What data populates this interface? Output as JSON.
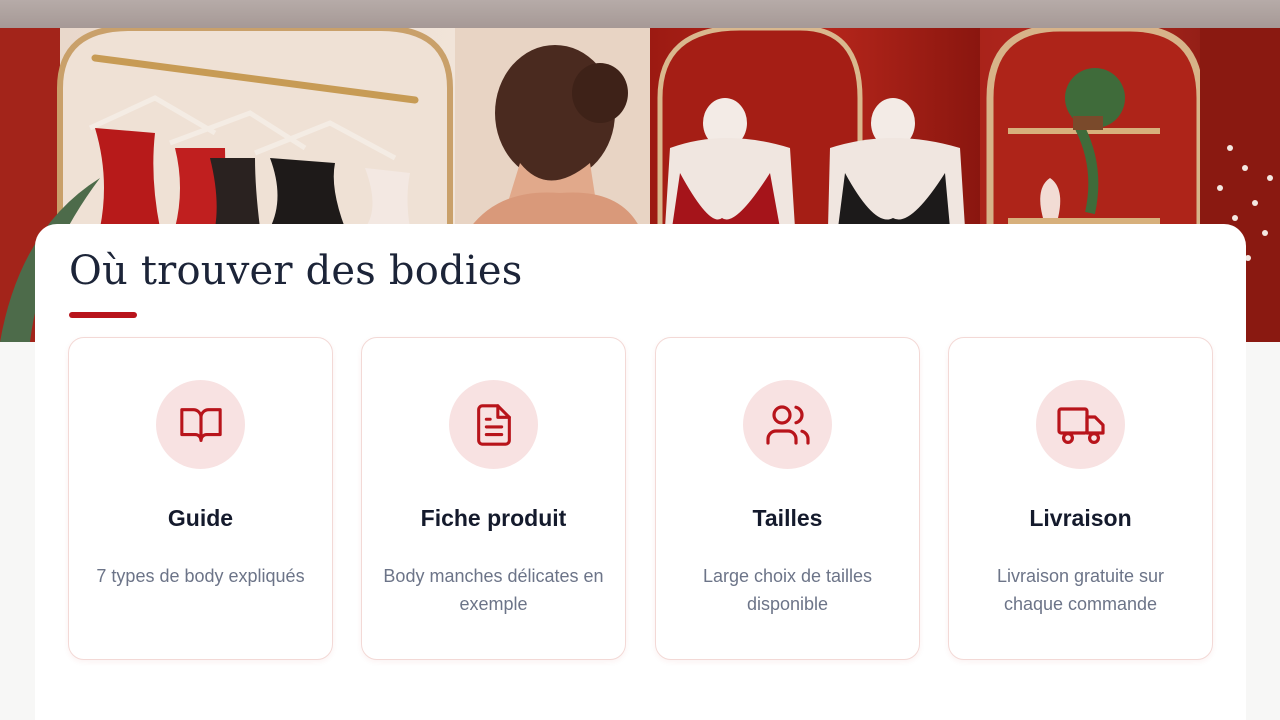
{
  "section": {
    "title": "Où trouver des bodies"
  },
  "cards": [
    {
      "icon": "book-icon",
      "title": "Guide",
      "description": "7 types de body expliqués"
    },
    {
      "icon": "document-icon",
      "title": "Fiche produit",
      "description": "Body manches délicates en exemple"
    },
    {
      "icon": "users-icon",
      "title": "Tailles",
      "description": "Large choix de tailles disponible"
    },
    {
      "icon": "truck-icon",
      "title": "Livraison",
      "description": "Livraison gratuite sur chaque commande"
    }
  ],
  "colors": {
    "accent": "#b8141b",
    "icon_bg": "#f8e2e2",
    "title_text": "#1c2438",
    "desc_text": "#6c7488"
  }
}
